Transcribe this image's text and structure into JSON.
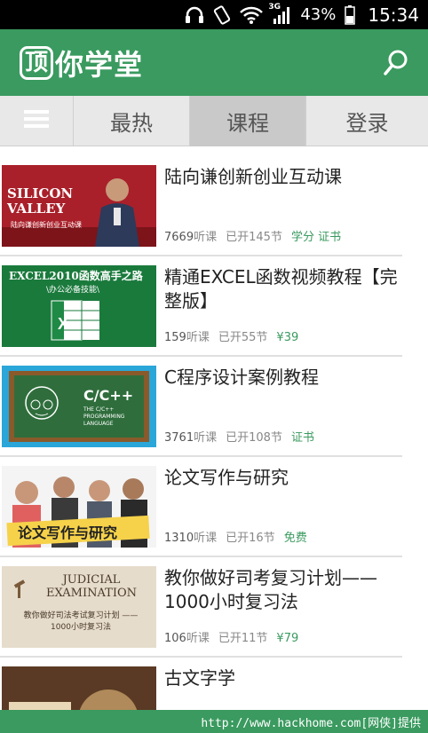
{
  "status_bar": {
    "network": "3G",
    "battery": "43%",
    "time": "15:34"
  },
  "header": {
    "logo_char": "顶",
    "logo_text": "你学堂",
    "icons": [
      "headphones-icon",
      "screen-rotate-icon",
      "wifi-icon",
      "signal-icon",
      "battery-icon",
      "search-icon"
    ]
  },
  "tabs": [
    {
      "label": "最热"
    },
    {
      "label": "课程"
    },
    {
      "label": "登录"
    }
  ],
  "courses": [
    {
      "title": "陆向谦创新创业互动课",
      "thumb_title": "SILICON VALLEY",
      "thumb_sub": "陆向谦创新创业互动课",
      "listeners": "7669",
      "listeners_unit": "听课",
      "sessions_prefix": "已开",
      "sessions": "145",
      "sessions_unit": "节",
      "price": "学分 证书"
    },
    {
      "title": "精通EXCEL函数视频教程【完整版】",
      "thumb_title": "EXCEL2010函数高手之路",
      "thumb_sub": "\\办公必备技能\\",
      "listeners": "159",
      "listeners_unit": "听课",
      "sessions_prefix": "已开",
      "sessions": "55",
      "sessions_unit": "节",
      "price": "¥39"
    },
    {
      "title": "C程序设计案例教程",
      "thumb_title": "C/C++",
      "thumb_sub": "THE C/C++ PROGRAMMING LANGUAGE",
      "listeners": "3761",
      "listeners_unit": "听课",
      "sessions_prefix": "已开",
      "sessions": "108",
      "sessions_unit": "节",
      "price": "证书"
    },
    {
      "title": "论文写作与研究",
      "thumb_title": "论文写作与研究",
      "thumb_sub": "",
      "listeners": "1310",
      "listeners_unit": "听课",
      "sessions_prefix": "已开",
      "sessions": "16",
      "sessions_unit": "节",
      "price": "免费"
    },
    {
      "title": "教你做好司考复习计划——1000小时复习法",
      "thumb_title": "JUDICIAL EXAMINATION",
      "thumb_sub": "教你做好司法考试复习计划 ——1000小时复习法",
      "listeners": "106",
      "listeners_unit": "听课",
      "sessions_prefix": "已开",
      "sessions": "11",
      "sessions_unit": "节",
      "price": "¥79"
    },
    {
      "title": "古文字学",
      "thumb_title": "",
      "thumb_sub": "",
      "listeners": "",
      "listeners_unit": "",
      "sessions_prefix": "",
      "sessions": "",
      "sessions_unit": "",
      "price": ""
    }
  ],
  "footer": {
    "watermark": "http://www.hackhome.com[网侠]提供"
  },
  "colors": {
    "brand_green": "#3a9a5f",
    "tab_bg": "#e8e8e8",
    "tab_active": "#c9c9c9"
  }
}
